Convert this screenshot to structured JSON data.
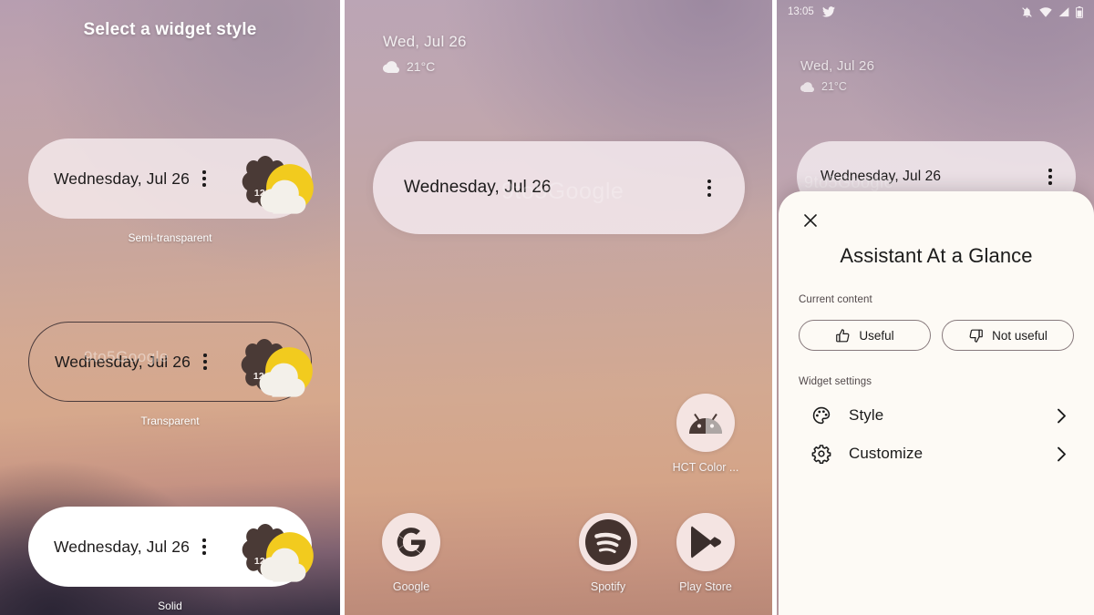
{
  "panel1": {
    "title": "Select a widget style",
    "options": [
      {
        "date": "Wednesday, Jul 26",
        "temp": "12°C",
        "caption": "Semi-transparent",
        "style_key": "semi-transparent"
      },
      {
        "date": "Wednesday, Jul 26",
        "temp": "12°C",
        "caption": "Transparent",
        "style_key": "transparent"
      },
      {
        "date": "Wednesday, Jul 26",
        "temp": "12°C",
        "caption": "Solid",
        "style_key": "solid"
      }
    ],
    "watermark": "9to5Google"
  },
  "panel2": {
    "weather": {
      "date": "Wed, Jul 26",
      "temp": "21°C",
      "condition_icon": "cloud-icon"
    },
    "glance_widget": {
      "date": "Wednesday, Jul 26",
      "menu_icon": "overflow-menu-icon"
    },
    "apps": [
      {
        "label": "HCT Color ...",
        "icon": "android-robot-icon"
      },
      {
        "label": "Google",
        "icon": "google-g-icon"
      },
      {
        "label": "Spotify",
        "icon": "spotify-icon"
      },
      {
        "label": "Play Store",
        "icon": "play-store-icon"
      }
    ],
    "watermark": "9to5Google"
  },
  "panel3": {
    "statusbar": {
      "time": "13:05",
      "notification_icon": "twitter-bird-icon",
      "icons": [
        "ringer-off-icon",
        "wifi-icon",
        "cellular-signal-icon",
        "battery-icon"
      ]
    },
    "weather": {
      "date": "Wed, Jul 26",
      "temp": "21°C",
      "condition_icon": "cloud-icon"
    },
    "glance_widget": {
      "date": "Wednesday, Jul 26",
      "menu_icon": "overflow-menu-icon"
    },
    "watermark": "9to5Google",
    "sheet": {
      "close_label": "Close",
      "title": "Assistant At a Glance",
      "current_content_label": "Current content",
      "feedback": [
        {
          "label": "Useful",
          "icon": "thumb-up-icon"
        },
        {
          "label": "Not useful",
          "icon": "thumb-down-icon"
        }
      ],
      "widget_settings_label": "Widget settings",
      "settings": [
        {
          "label": "Style",
          "icon": "palette-icon",
          "chevron": "chevron-right-icon"
        },
        {
          "label": "Customize",
          "icon": "gear-icon",
          "chevron": "chevron-right-icon"
        }
      ]
    }
  },
  "colors": {
    "badge_dark": "#4a3a36",
    "sun_yellow": "#f2cb1e",
    "sheet_bg": "#fdfaf5",
    "accent_text": "#1b1b1b"
  }
}
